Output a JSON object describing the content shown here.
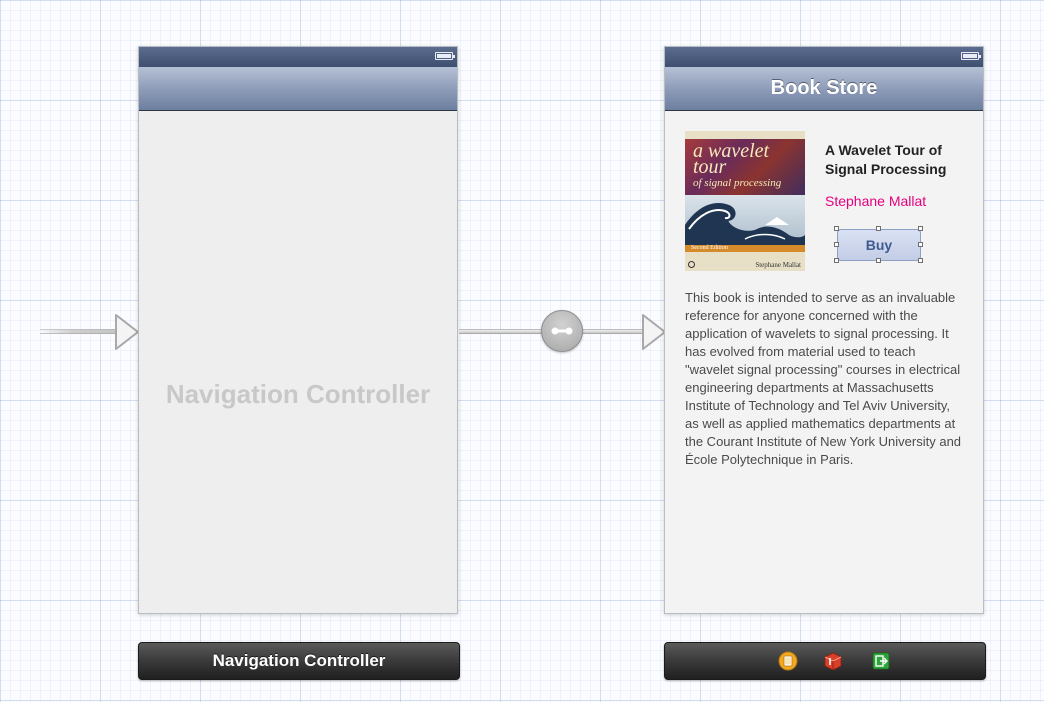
{
  "navigation_scene": {
    "placeholder_label": "Navigation Controller",
    "dock_label": "Navigation Controller"
  },
  "book_scene": {
    "nav_title": "Book Store",
    "book": {
      "title": "A Wavelet Tour of Signal Processing",
      "author": "Stephane Mallat",
      "buy_label": "Buy",
      "description": "This book is intended to serve as an invaluable reference for anyone concerned with the application of wavelets to signal processing. It has evolved from material used to teach \"wavelet signal processing\" courses in electrical engineering departments at Massachusetts Institute of Technology and Tel Aviv University, as well as applied mathematics departments at the Courant Institute of New York University and École Polytechnique in Paris.",
      "cover": {
        "title": "a wavelet tour",
        "subtitle": "of signal processing",
        "edition": "Second Edition",
        "author": "Stephane Mallat"
      }
    },
    "dock_icons": [
      "view-controller-icon",
      "first-responder-icon",
      "exit-icon"
    ]
  },
  "colors": {
    "nav_bar": "#8e9db9",
    "status_bar": "#4a5a7c",
    "author_text": "#e6007e",
    "buy_text": "#3e5a8e",
    "dock": "#3a3a3a"
  }
}
